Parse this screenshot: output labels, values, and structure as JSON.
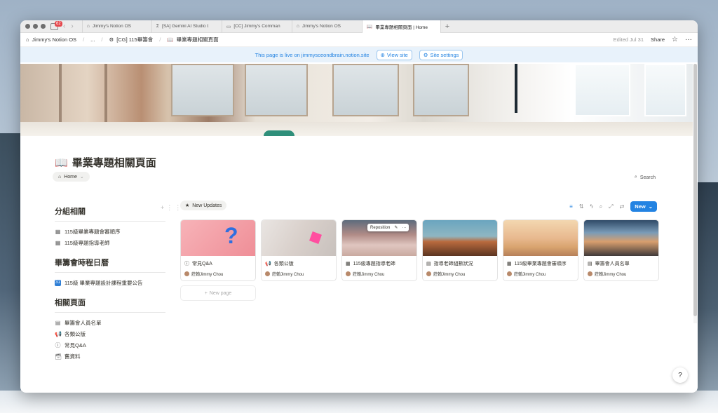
{
  "browser": {
    "notification_count": "62",
    "tabs": [
      {
        "label": "Jimmy's Notion OS",
        "icon": "home-icon"
      },
      {
        "label": "[SA] Gemini AI Studio t",
        "icon": "sigma-icon"
      },
      {
        "label": "[CC] Jimmy's Comman",
        "icon": "card-icon"
      },
      {
        "label": "Jimmy's Notion OS",
        "icon": "home-icon"
      },
      {
        "label": "畢業專題相關頁面 | Home",
        "icon": "book-icon",
        "active": true
      }
    ]
  },
  "header": {
    "breadcrumb": [
      "Jimmy's Notion OS",
      "...",
      "[CG] 115畢籌會",
      "畢業專題相關頁面"
    ],
    "edited": "Edited Jul 31",
    "share": "Share"
  },
  "banner": {
    "text": "This page is live on jimmysceondbrain.notion.site",
    "view_site": "View site",
    "site_settings": "Site settings"
  },
  "page": {
    "title": "畢業專題相關頁面",
    "home_pill": "Home",
    "search": "Search"
  },
  "left_sections": [
    {
      "heading": "分組相關",
      "items": [
        {
          "label": "115級畢業專題會審順序",
          "icon": "table-icon"
        },
        {
          "label": "115級專題指導老師",
          "icon": "table-icon"
        }
      ]
    },
    {
      "heading": "畢籌會時程日曆",
      "items": [
        {
          "label": "115級 畢業專題設計課程重要公告",
          "icon": "calendar-icon",
          "date": "31"
        }
      ]
    },
    {
      "heading": "相關頁面",
      "items": [
        {
          "label": "畢籌會人員名單",
          "icon": "document-icon"
        },
        {
          "label": "各類公版",
          "icon": "megaphone-icon"
        },
        {
          "label": "常見Q&A",
          "icon": "info-icon"
        },
        {
          "label": "舊資料",
          "icon": "archive-icon"
        }
      ]
    }
  ],
  "gallery": {
    "view_tab": "New Updates",
    "new_button": "New",
    "new_page": "New page",
    "reposition": "Reposition",
    "cards": [
      {
        "title": "常見Q&A",
        "icon": "info-icon",
        "author": "莊翰Jimmy Chou",
        "thumb": "t1"
      },
      {
        "title": "各類公版",
        "icon": "megaphone-icon",
        "author": "莊翰Jimmy Chou",
        "thumb": "t2"
      },
      {
        "title": "115級專題指導老師",
        "icon": "table-icon",
        "author": "莊翰Jimmy Chou",
        "thumb": "t3"
      },
      {
        "title": "指導老師組數狀況",
        "icon": "document-icon",
        "author": "莊翰Jimmy Chou",
        "thumb": "t4"
      },
      {
        "title": "115級畢業專題會審順序",
        "icon": "table-icon",
        "author": "莊翰Jimmy Chou",
        "thumb": "t5"
      },
      {
        "title": "畢籌會人員名單",
        "icon": "document-icon",
        "author": "莊翰Jimmy Chou",
        "thumb": "t6"
      }
    ]
  },
  "colors": {
    "accent": "#2383e2",
    "banner_bg": "#e8f2fb",
    "text": "#37352f"
  }
}
